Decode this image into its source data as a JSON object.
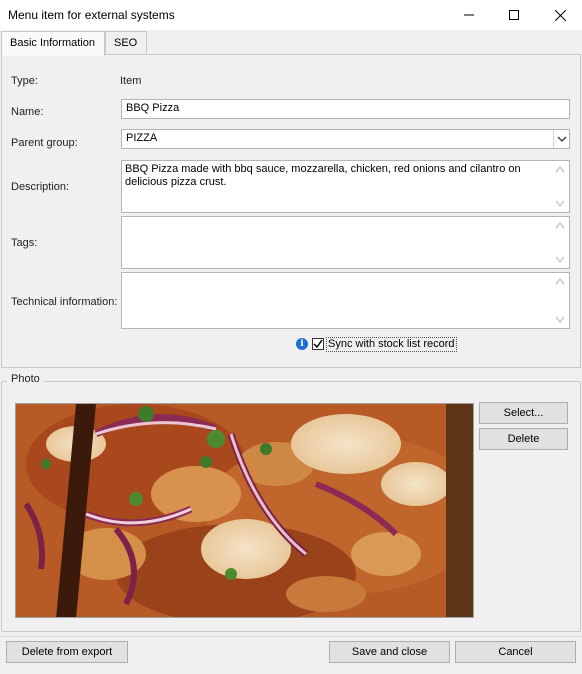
{
  "window": {
    "title": "Menu item for external systems",
    "minimize_icon": "minimize-icon",
    "maximize_icon": "maximize-icon",
    "close_icon": "close-icon"
  },
  "tabs": [
    {
      "label": "Basic Information",
      "active": true
    },
    {
      "label": "SEO",
      "active": false
    }
  ],
  "form": {
    "type_label": "Type:",
    "type_value": "Item",
    "name_label": "Name:",
    "name_value": "BBQ Pizza",
    "parent_label": "Parent group:",
    "parent_value": "PIZZA",
    "description_label": "Description:",
    "description_value": "BBQ Pizza made with bbq sauce, mozzarella, chicken, red onions and cilantro on delicious pizza crust.",
    "tags_label": "Tags:",
    "tags_value": "",
    "tech_label": "Technical information:",
    "tech_value": "",
    "sync_label": "Sync with stock list record",
    "sync_checked": true
  },
  "photo": {
    "group_label": "Photo",
    "select_button": "Select...",
    "delete_button": "Delete"
  },
  "footer": {
    "delete_export_button": "Delete from export",
    "save_close_button": "Save and close",
    "cancel_button": "Cancel"
  }
}
